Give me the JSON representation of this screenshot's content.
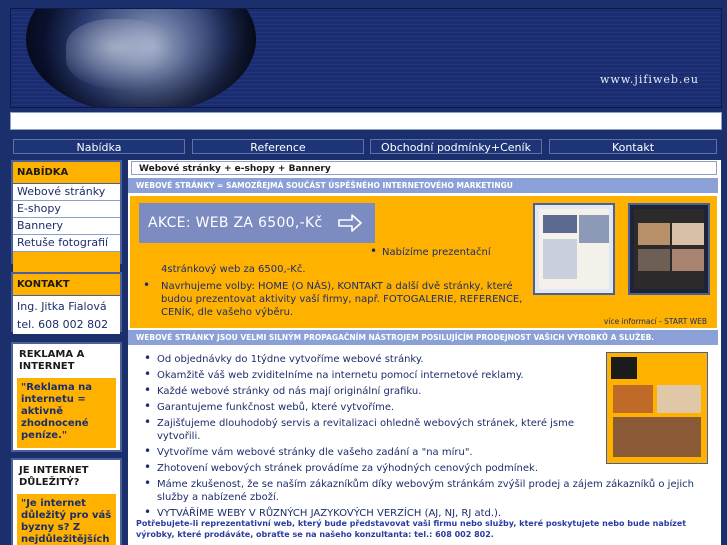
{
  "header": {
    "site_url": "www.jifiweb.eu"
  },
  "nav": [
    {
      "label": "Nabídka"
    },
    {
      "label": "Reference"
    },
    {
      "label": "Obchodní podmínky+Ceník"
    },
    {
      "label": "Kontakt"
    }
  ],
  "sidebar": {
    "menu_title": "NABÍDKA",
    "menu_items": [
      {
        "label": "Webové stránky"
      },
      {
        "label": "E-shopy"
      },
      {
        "label": "Bannery"
      },
      {
        "label": "Retuše fotografií"
      }
    ],
    "contact_title": "KONTAKT",
    "contact_name": "Ing. Jitka Fialová",
    "contact_phone": "tel. 608 002 802",
    "ad_title": "REKLAMA A INTERNET",
    "ad_text": "\"Reklama na internetu = aktivně zhodnocené peníze.\"",
    "important_title": "JE INTERNET DŮLEŽITÝ?",
    "important_text": "\"Je internet důležitý pro váš byzny s? Z nejdůležitějších"
  },
  "main": {
    "breadcrumb": "Webové stránky + e-shopy + Bannery",
    "bar1": "WEBOVÉ STRÁNKY = SAMOZŘEJMÁ SOUČÁST ÚSPĚŠNÉHO INTERNETOVÉHO MARKETINGU",
    "akce": "AKCE:  WEB ZA 6500,-Kč",
    "offer_line1": "Nabízíme prezentační",
    "offer_line2": "4stránkový web za 6500,-Kč.",
    "offer_bullet2": "Navrhujeme volby: HOME (O NÁS), KONTAKT a další dvě stránky, které budou prezentovat aktivity vaší firmy, např. FOTOGALERIE, REFERENCE, CENÍK, dle vašeho výběru.",
    "more_link": "více informací - START WEB",
    "bar2": "WEBOVÉ STRÁNKY JSOU VELMI SILNÝM PROPAGAČNÍM NÁSTROJEM POSILUJÍCÍM PRODEJNOST VAŠICH VÝROBKŮ A SLUŽEB.",
    "list": [
      "Od objednávky do 1týdne vytvoříme webové stránky.",
      "Okamžitě váš web zviditelníme na internetu pomocí internetové reklamy.",
      "Každé webové stránky od nás mají originální grafiku.",
      "Garantujeme funkčnost webů, které vytvoříme.",
      "Zajišťujeme dlouhodobý servis a revitalizaci ohledně webových stránek, které jsme vytvořili.",
      "Vytvoříme vám webové stránky dle vašeho zadání a \"na míru\".",
      "Zhotovení webových stránek provádíme za výhodných cenových podmínek.",
      "Máme zkušenost, že se naším zákazníkům díky webovým stránkám zvýšil prodej a zájem zákazníků o jejich služby a nabízené zboží.",
      "VYTVÁŘÍME WEBY V RŮZNÝCH JAZYKOVÝCH VERZÍCH (AJ, NJ, RJ atd.)."
    ],
    "footer_note": "Potřebujete-li reprezentativní web, který bude představovat vaši firmu nebo služby, které poskytujete nebo bude nabízet výrobky, které prodáváte, obraťte se na našeho konzultanta: tel.: 608 002 802."
  },
  "colors": {
    "navy": "#1a2f6b",
    "orange": "#ffb100",
    "bar": "#8aa0d6"
  }
}
